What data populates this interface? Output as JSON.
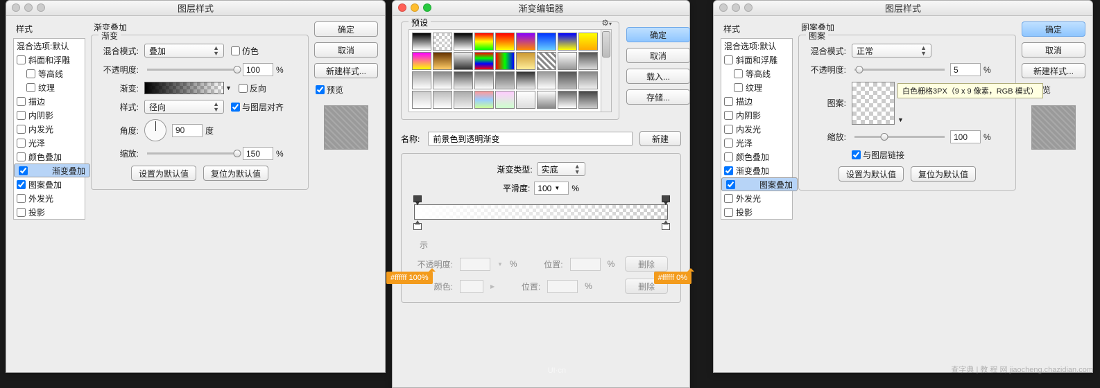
{
  "win_ls": {
    "title": "图层样式",
    "styles_header": "样式",
    "side_header": "渐变叠加",
    "items": [
      {
        "label": "混合选项:默认",
        "checked": false,
        "indent": false,
        "sel": false
      },
      {
        "label": "斜面和浮雕",
        "checked": false,
        "indent": false,
        "sel": false
      },
      {
        "label": "等高线",
        "checked": false,
        "indent": true,
        "sel": false
      },
      {
        "label": "纹理",
        "checked": false,
        "indent": true,
        "sel": false
      },
      {
        "label": "描边",
        "checked": false,
        "indent": false,
        "sel": false
      },
      {
        "label": "内阴影",
        "checked": false,
        "indent": false,
        "sel": false
      },
      {
        "label": "内发光",
        "checked": false,
        "indent": false,
        "sel": false
      },
      {
        "label": "光泽",
        "checked": false,
        "indent": false,
        "sel": false
      },
      {
        "label": "颜色叠加",
        "checked": false,
        "indent": false,
        "sel": false
      },
      {
        "label": "渐变叠加",
        "checked": true,
        "indent": false,
        "sel": true
      },
      {
        "label": "图案叠加",
        "checked": true,
        "indent": false,
        "sel": false
      },
      {
        "label": "外发光",
        "checked": false,
        "indent": false,
        "sel": false
      },
      {
        "label": "投影",
        "checked": false,
        "indent": false,
        "sel": false
      }
    ],
    "group_legend": "渐变",
    "blend_mode_label": "混合模式:",
    "blend_mode_value": "叠加",
    "dither_label": "仿色",
    "opacity_label": "不透明度:",
    "opacity_value": "100",
    "percent": "%",
    "gradient_label": "渐变:",
    "reverse_label": "反向",
    "style_label": "样式:",
    "style_value": "径向",
    "align_label": "与图层对齐",
    "align_checked": true,
    "angle_label": "角度:",
    "angle_value": "90",
    "angle_unit": "度",
    "scale_label": "缩放:",
    "scale_value": "150",
    "make_default": "设置为默认值",
    "reset_default": "复位为默认值",
    "ok": "确定",
    "cancel": "取消",
    "new_style": "新建样式...",
    "preview": "预览"
  },
  "win_ge": {
    "title": "渐变编辑器",
    "preset_label": "预设",
    "ok": "确定",
    "cancel": "取消",
    "load": "载入...",
    "save": "存储...",
    "new": "新建",
    "name_label": "名称:",
    "name_value": "前景色到透明渐变",
    "type_label": "渐变类型:",
    "type_value": "实底",
    "smooth_label": "平滑度:",
    "smooth_value": "100",
    "percent": "%",
    "stops_header": "色标",
    "stop_left": "#ffffff 100%",
    "stop_right": "#ffffff 0%",
    "opacity_label": "不透明度:",
    "position_label": "位置:",
    "color_label": "颜色:",
    "delete": "删除"
  },
  "chart_data": {
    "type": "table",
    "title": "gradient_stops",
    "series": [
      {
        "name": "color_stops",
        "values": [
          {
            "position": 0,
            "color": "#ffffff",
            "opacity": 100
          },
          {
            "position": 100,
            "color": "#ffffff",
            "opacity": 0
          }
        ]
      }
    ]
  },
  "win_po": {
    "title": "图层样式",
    "styles_header": "样式",
    "side_header": "图案叠加",
    "items": [
      {
        "label": "混合选项:默认",
        "checked": false,
        "indent": false,
        "sel": false
      },
      {
        "label": "斜面和浮雕",
        "checked": false,
        "indent": false,
        "sel": false
      },
      {
        "label": "等高线",
        "checked": false,
        "indent": true,
        "sel": false
      },
      {
        "label": "纹理",
        "checked": false,
        "indent": true,
        "sel": false
      },
      {
        "label": "描边",
        "checked": false,
        "indent": false,
        "sel": false
      },
      {
        "label": "内阴影",
        "checked": false,
        "indent": false,
        "sel": false
      },
      {
        "label": "内发光",
        "checked": false,
        "indent": false,
        "sel": false
      },
      {
        "label": "光泽",
        "checked": false,
        "indent": false,
        "sel": false
      },
      {
        "label": "颜色叠加",
        "checked": false,
        "indent": false,
        "sel": false
      },
      {
        "label": "渐变叠加",
        "checked": true,
        "indent": false,
        "sel": false
      },
      {
        "label": "图案叠加",
        "checked": true,
        "indent": false,
        "sel": true
      },
      {
        "label": "外发光",
        "checked": false,
        "indent": false,
        "sel": false
      },
      {
        "label": "投影",
        "checked": false,
        "indent": false,
        "sel": false
      }
    ],
    "group_legend": "图案",
    "blend_mode_label": "混合模式:",
    "blend_mode_value": "正常",
    "opacity_label": "不透明度:",
    "opacity_value": "5",
    "pattern_label": "图案:",
    "tooltip": "白色栅格3PX（9 x 9 像素，RGB 模式）",
    "scale_label": "缩放:",
    "scale_value": "100",
    "link_label": "与图层链接",
    "link_checked": true,
    "make_default": "设置为默认值",
    "reset_default": "复位为默认值",
    "ok": "确定",
    "cancel": "取消",
    "new_style": "新建样式...",
    "preview": "预览",
    "percent": "%"
  },
  "watermark_left": "UI·cn",
  "watermark_right": "查字典 | 教 程 网  jiaocheng.chazidian.com"
}
